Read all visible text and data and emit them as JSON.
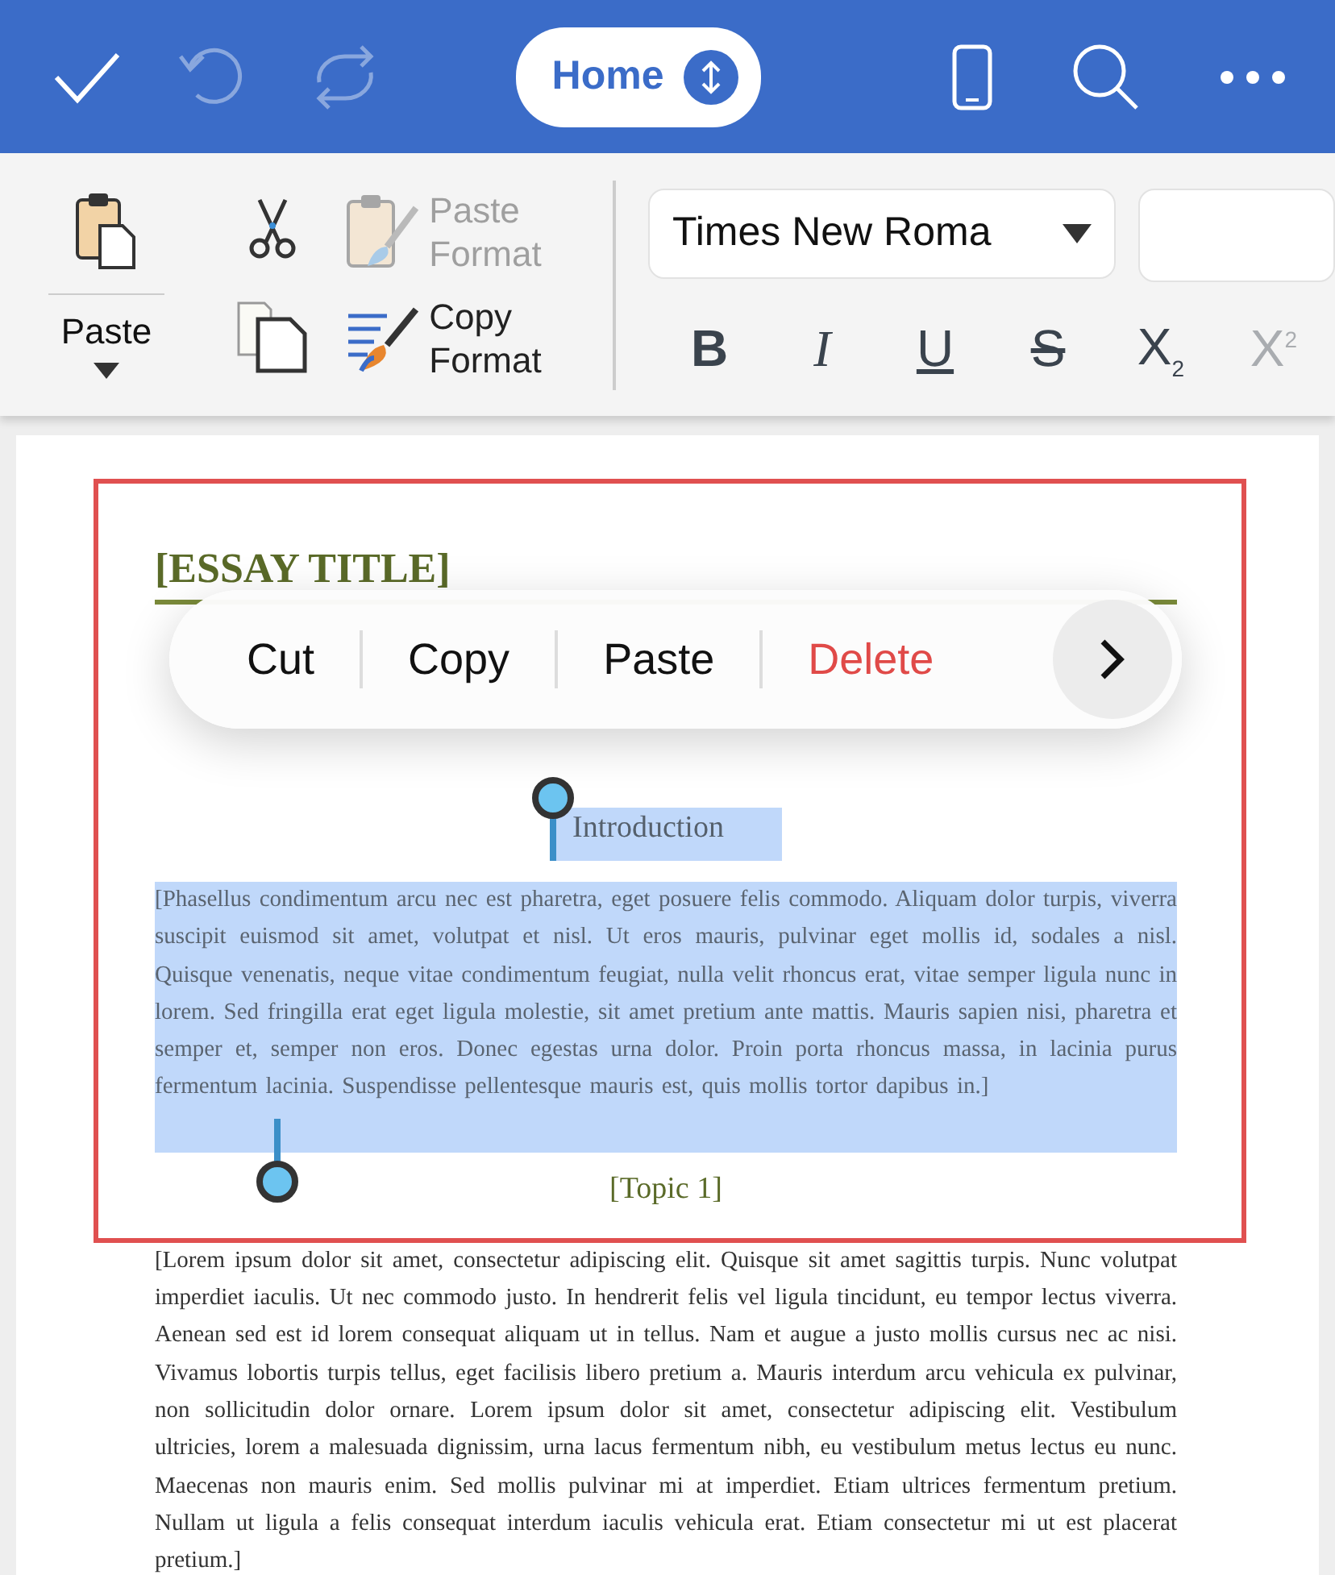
{
  "top_bar": {
    "actions": [
      {
        "kind": "check",
        "disabled": false
      },
      {
        "kind": "undo",
        "disabled": true
      },
      {
        "kind": "redo",
        "disabled": true
      }
    ],
    "tab_switch": {
      "label": "Home"
    },
    "right_actions": [
      {
        "kind": "phone"
      },
      {
        "kind": "search"
      },
      {
        "kind": "more"
      }
    ]
  },
  "ribbon": {
    "paste": {
      "label": "Paste"
    },
    "clip_buttons": [
      {
        "kind": "cut",
        "disabled": false
      },
      {
        "kind": "copy",
        "disabled": false
      }
    ],
    "format_buttons": [
      {
        "kind": "paste-format",
        "label": "Paste Format",
        "disabled": true
      },
      {
        "kind": "copy-format",
        "label": "Copy Format",
        "disabled": false
      }
    ],
    "font_field": {
      "value": "Times New Roma"
    },
    "style_buttons": [
      {
        "kind": "bold",
        "label": "B",
        "disabled": false
      },
      {
        "kind": "italic",
        "label": "I",
        "disabled": false
      },
      {
        "kind": "underline",
        "label": "U",
        "disabled": false
      },
      {
        "kind": "strike",
        "label": "S",
        "disabled": false
      },
      {
        "kind": "sub",
        "label": "X",
        "sub": "2",
        "disabled": false
      },
      {
        "kind": "sup",
        "label": "X",
        "sup": "2",
        "disabled": true
      }
    ]
  },
  "document": {
    "title": "[ESSAY TITLE]",
    "context_menu": {
      "items": [
        {
          "label": "Cut",
          "kind": "normal"
        },
        {
          "label": "Copy",
          "kind": "normal"
        },
        {
          "label": "Paste",
          "kind": "normal"
        },
        {
          "label": "Delete",
          "kind": "destructive"
        }
      ]
    },
    "blocks": [
      {
        "kind": "heading",
        "text": "Introduction",
        "selected": true
      },
      {
        "kind": "paragraph",
        "text": "[Phasellus condimentum arcu nec est pharetra, eget posuere felis commodo. Aliquam dolor turpis, viverra suscipit euismod sit amet, volutpat et nisl. Ut eros mauris, pulvinar eget mollis id, sodales a nisl. Quisque venenatis, neque vitae condimentum feugiat, nulla velit rhoncus erat, vitae semper ligula nunc in lorem. Sed fringilla erat eget ligula molestie, sit amet pretium ante mattis. Mauris sapien nisi, pharetra et semper et, semper non eros. Donec egestas urna dolor. Proin porta rhoncus massa, in lacinia purus fermentum lacinia. Suspendisse pellentesque mauris est, quis mollis tortor dapibus in.]",
        "selected": true
      },
      {
        "kind": "heading",
        "text": "[Topic 1]",
        "selected": false
      },
      {
        "kind": "paragraph",
        "text": "[Lorem ipsum dolor sit amet, consectetur adipiscing elit. Quisque sit amet sagittis turpis. Nunc volutpat imperdiet iaculis. Ut nec commodo justo. In hendrerit felis vel ligula tincidunt, eu tempor lectus viverra. Aenean sed est id lorem consequat aliquam ut in tellus. Nam et augue a justo mollis cursus nec ac nisi. Vivamus lobortis turpis tellus, eget facilisis libero pretium a. Mauris interdum arcu vehicula ex pulvinar, non sollicitudin dolor ornare. Lorem ipsum dolor sit amet, consectetur adipiscing elit. Vestibulum ultricies, lorem a malesuada dignissim, urna lacus fermentum nibh, eu vestibulum metus lectus eu nunc. Maecenas non mauris enim. Sed mollis pulvinar mi at imperdiet. Etiam ultrices fermentum pretium. Nullam ut ligula a felis consequat interdum iaculis vehicula erat. Etiam consectetur mi ut est placerat pretium.]",
        "selected": false
      }
    ]
  }
}
